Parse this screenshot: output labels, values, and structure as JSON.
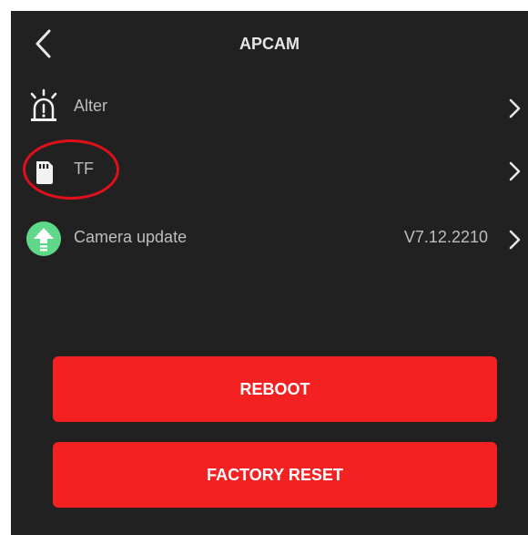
{
  "header": {
    "title": "APCAM",
    "back_icon": "chevron-left-icon"
  },
  "rows": [
    {
      "label": "Alter",
      "icon": "alarm-light-icon",
      "value": ""
    },
    {
      "label": "TF",
      "icon": "sd-card-icon",
      "value": ""
    },
    {
      "label": "Camera update",
      "icon": "upload-arrow-icon",
      "value": "V7.12.2210"
    }
  ],
  "buttons": {
    "reboot_label": "REBOOT",
    "factory_reset_label": "FACTORY RESET"
  },
  "colors": {
    "background": "#212121",
    "accent_red": "#f32121",
    "update_icon_green": "#5fd888",
    "annotation_red": "#e0101b"
  }
}
